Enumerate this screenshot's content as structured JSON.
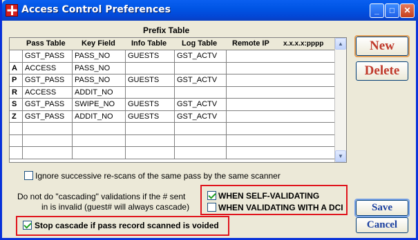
{
  "window": {
    "title": "Access Control Preferences"
  },
  "titlebar": {
    "min_label": "_",
    "max_label": "□",
    "close_label": "✕"
  },
  "prefix_table": {
    "title": "Prefix Table",
    "headers": [
      "Pass Table",
      "Key Field",
      "Info Table",
      "Log Table",
      "Remote IP",
      "x.x.x.x:pppp"
    ],
    "rows": [
      {
        "prefix": "",
        "pass_table": "GST_PASS",
        "key_field": "PASS_NO",
        "info_table": "GUESTS",
        "log_table": "GST_ACTV",
        "remote_ip": ""
      },
      {
        "prefix": "A",
        "pass_table": "ACCESS",
        "key_field": "PASS_NO",
        "info_table": "",
        "log_table": "",
        "remote_ip": ""
      },
      {
        "prefix": "P",
        "pass_table": "GST_PASS",
        "key_field": "PASS_NO",
        "info_table": "GUESTS",
        "log_table": "GST_ACTV",
        "remote_ip": ""
      },
      {
        "prefix": "R",
        "pass_table": "ACCESS",
        "key_field": "ADDIT_NO",
        "info_table": "",
        "log_table": "",
        "remote_ip": ""
      },
      {
        "prefix": "S",
        "pass_table": "GST_PASS",
        "key_field": "SWIPE_NO",
        "info_table": "GUESTS",
        "log_table": "GST_ACTV",
        "remote_ip": ""
      },
      {
        "prefix": "Z",
        "pass_table": "GST_PASS",
        "key_field": "ADDIT_NO",
        "info_table": "GUESTS",
        "log_table": "GST_ACTV",
        "remote_ip": ""
      },
      {
        "prefix": "",
        "pass_table": "",
        "key_field": "",
        "info_table": "",
        "log_table": "",
        "remote_ip": ""
      },
      {
        "prefix": "",
        "pass_table": "",
        "key_field": "",
        "info_table": "",
        "log_table": "",
        "remote_ip": ""
      },
      {
        "prefix": "",
        "pass_table": "",
        "key_field": "",
        "info_table": "",
        "log_table": "",
        "remote_ip": ""
      }
    ]
  },
  "buttons": {
    "new": "New",
    "delete": "Delete",
    "save": "Save",
    "cancel": "Cancel"
  },
  "options": {
    "ignore_rescans": {
      "label": "Ignore successive re-scans of the same pass by the same scanner",
      "checked": false
    },
    "cascade_text_line1": "Do not do \"cascading\" validations if the # sent",
    "cascade_text_line2": "in is invalid (guest# will always cascade)",
    "when_self_validating": {
      "label": "WHEN SELF-VALIDATING",
      "checked": true
    },
    "when_validating_dci": {
      "label": "WHEN VALIDATING WITH A DCI",
      "checked": false
    },
    "stop_cascade": {
      "label": "Stop cascade if pass record scanned is voided",
      "checked": true
    }
  },
  "colors": {
    "title_bar": "#0055e5",
    "new_delete_text": "#c0392b",
    "save_cancel_text": "#1a3fa0",
    "highlight_box": "#e0141c"
  }
}
